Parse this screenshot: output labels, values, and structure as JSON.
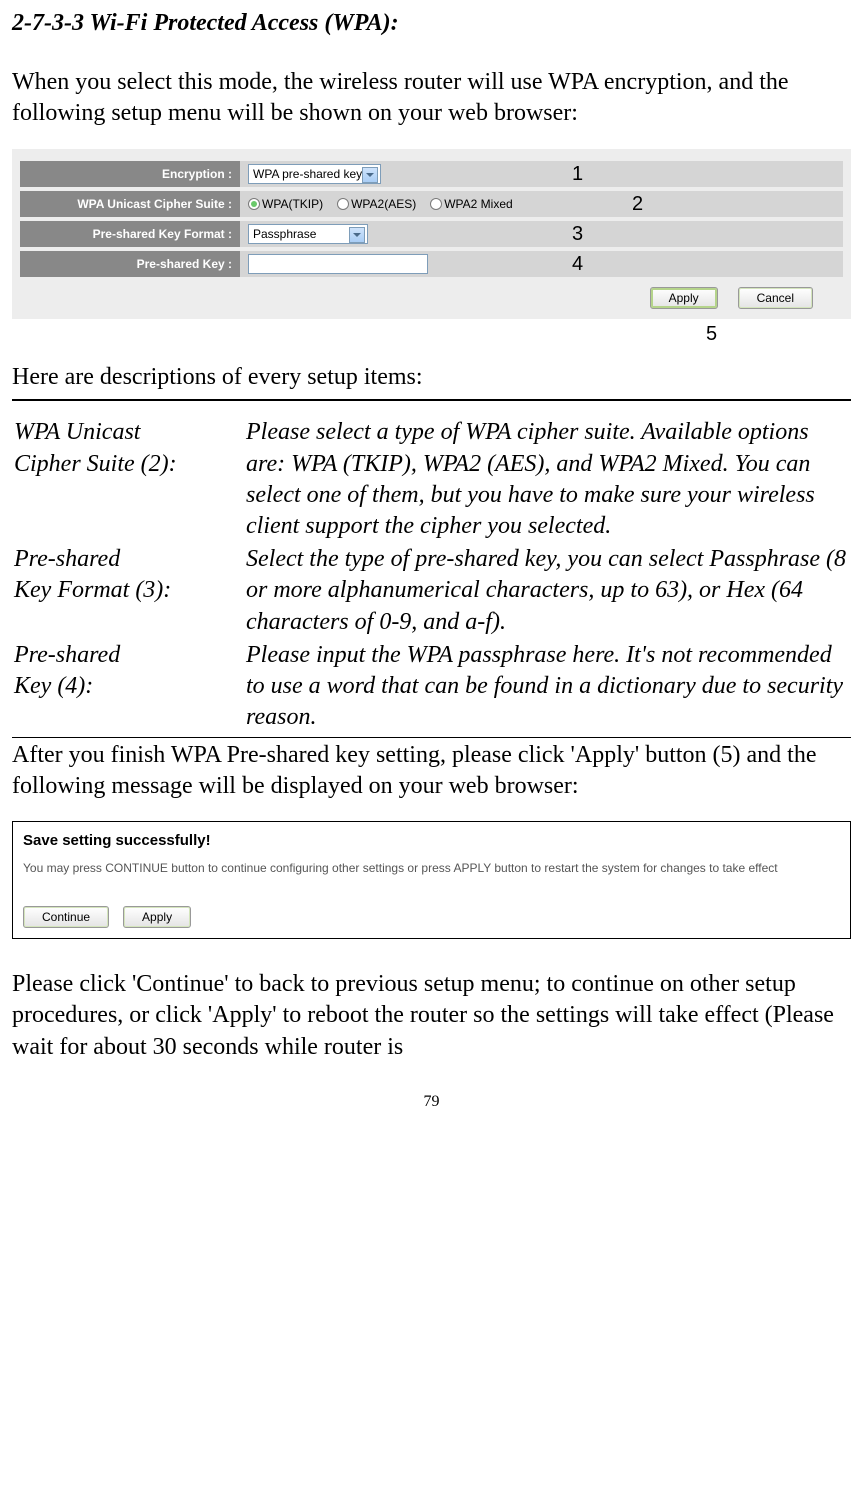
{
  "section_title": "2-7-3-3 Wi-Fi Protected Access (WPA):",
  "intro_text": "When you select this mode, the wireless router will use WPA encryption, and the following setup menu will be shown on your web browser:",
  "form": {
    "encryption": {
      "label": "Encryption :",
      "value": "WPA pre-shared key"
    },
    "cipher": {
      "label": "WPA Unicast Cipher Suite :",
      "options": [
        "WPA(TKIP)",
        "WPA2(AES)",
        "WPA2 Mixed"
      ],
      "selected": 0
    },
    "keyformat": {
      "label": "Pre-shared Key Format :",
      "value": "Passphrase"
    },
    "key": {
      "label": "Pre-shared Key :",
      "value": ""
    },
    "apply": "Apply",
    "cancel": "Cancel"
  },
  "badges": {
    "n1": "1",
    "n2": "2",
    "n3": "3",
    "n4": "4",
    "n5": "5"
  },
  "desc_intro": "Here are descriptions of every setup items:",
  "descriptions": [
    {
      "left1": "WPA Unicast",
      "left2": "Cipher Suite (2):",
      "right": "Please select a type of WPA cipher suite. Available options are: WPA (TKIP), WPA2 (AES), and WPA2 Mixed. You can select one of them, but you have to make sure your wireless client support the cipher you selected."
    },
    {
      "left1": "Pre-shared",
      "left2": "Key Format (3):",
      "right": "Select the type of pre-shared key, you can select Passphrase (8 or more alphanumerical characters, up to 63), or Hex (64 characters of 0-9, and a-f)."
    },
    {
      "left1": "Pre-shared",
      "left2": "Key (4):",
      "right": "Please input the WPA passphrase here. It's not recommended to use a word that can be found in a dictionary due to security reason."
    }
  ],
  "after_text": "After you finish WPA Pre-shared key setting, please click 'Apply' button (5) and the following message will be displayed on your web browser:",
  "save_dialog": {
    "title": "Save setting successfully!",
    "text": "You may press CONTINUE button to continue configuring other settings or press APPLY button to restart the system for changes to take effect",
    "continue": "Continue",
    "apply": "Apply"
  },
  "final_text": "Please click 'Continue' to back to previous setup menu; to continue on other setup procedures, or click 'Apply' to reboot the router so the settings will take effect (Please wait for about 30 seconds while router is",
  "page_number": "79"
}
